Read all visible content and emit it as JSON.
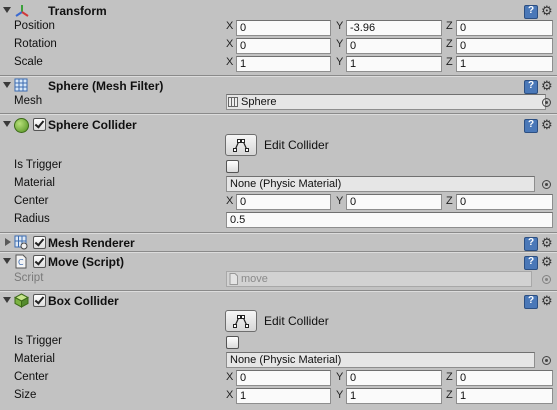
{
  "components": {
    "transform": {
      "title": "Transform",
      "rows": [
        {
          "label": "Position",
          "x": "0",
          "y": "-3.96",
          "z": "0"
        },
        {
          "label": "Rotation",
          "x": "0",
          "y": "0",
          "z": "0"
        },
        {
          "label": "Scale",
          "x": "1",
          "y": "1",
          "z": "1"
        }
      ]
    },
    "mesh_filter": {
      "title": "Sphere (Mesh Filter)",
      "mesh_label": "Mesh",
      "mesh_value": "Sphere"
    },
    "sphere_collider": {
      "title": "Sphere Collider",
      "enabled": true,
      "edit_collider_label": "Edit Collider",
      "is_trigger_label": "Is Trigger",
      "is_trigger": false,
      "material_label": "Material",
      "material_value": "None (Physic Material)",
      "center_label": "Center",
      "center": {
        "x": "0",
        "y": "0",
        "z": "0"
      },
      "radius_label": "Radius",
      "radius_value": "0.5"
    },
    "mesh_renderer": {
      "title": "Mesh Renderer",
      "enabled": true
    },
    "move_script": {
      "title": "Move (Script)",
      "enabled": true,
      "script_label": "Script",
      "script_value": "move"
    },
    "box_collider": {
      "title": "Box Collider",
      "enabled": true,
      "edit_collider_label": "Edit Collider",
      "is_trigger_label": "Is Trigger",
      "is_trigger": false,
      "material_label": "Material",
      "material_value": "None (Physic Material)",
      "center_label": "Center",
      "center": {
        "x": "0",
        "y": "0",
        "z": "0"
      },
      "size_label": "Size",
      "size": {
        "x": "1",
        "y": "1",
        "z": "1"
      }
    }
  },
  "axis_labels": {
    "x": "X",
    "y": "Y",
    "z": "Z"
  },
  "colors": {
    "panel": "#c2c2c2",
    "help_icon": "#4a78b8",
    "sphere_icon": "#6db33f",
    "box_icon": "#7cb342"
  }
}
